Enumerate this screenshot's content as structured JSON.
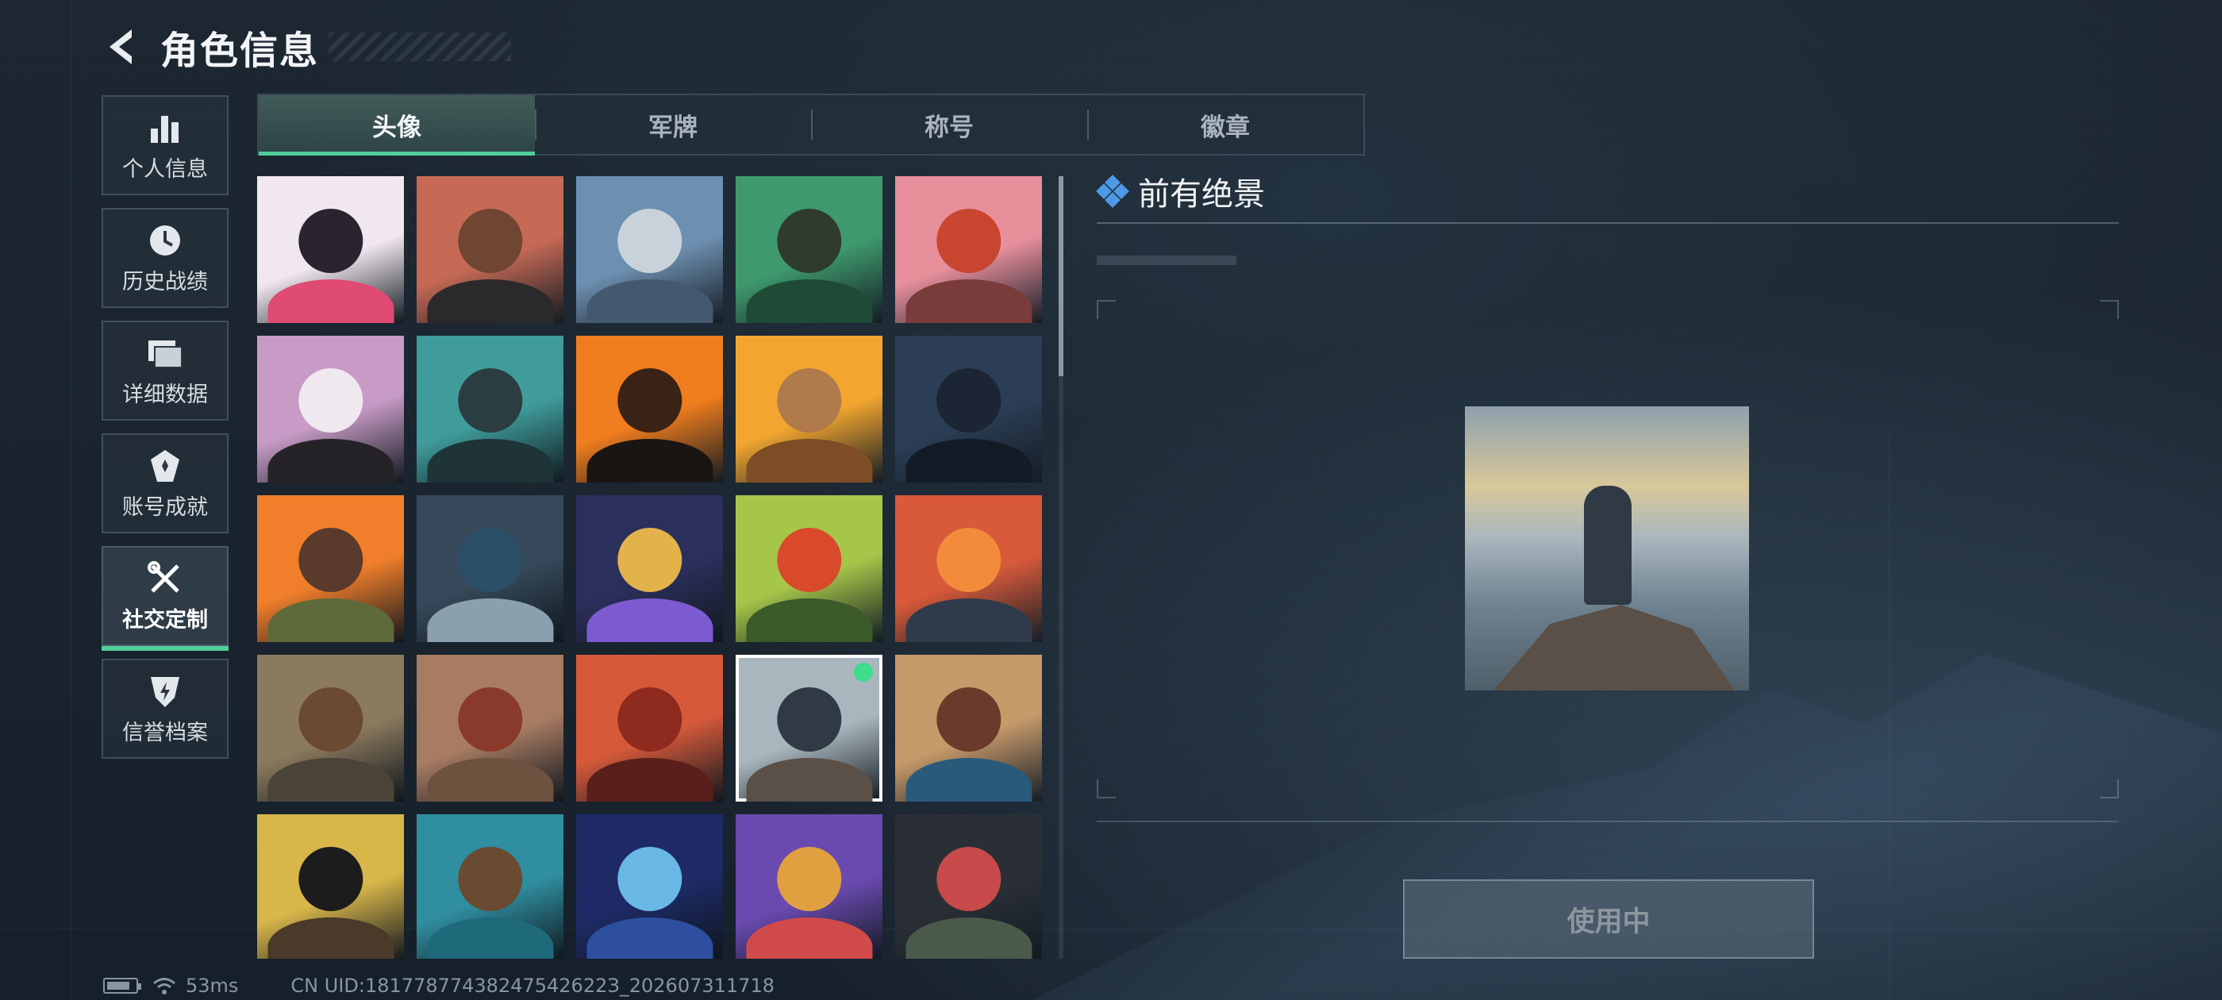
{
  "header": {
    "title": "角色信息"
  },
  "sidebar": {
    "items": [
      {
        "label": "个人信息",
        "icon": "bar-chart-icon",
        "active": false
      },
      {
        "label": "历史战绩",
        "icon": "clock-history-icon",
        "active": false
      },
      {
        "label": "详细数据",
        "icon": "folder-stack-icon",
        "active": false
      },
      {
        "label": "账号成就",
        "icon": "achievement-badge-icon",
        "active": false
      },
      {
        "label": "社交定制",
        "icon": "wrench-screwdriver-icon",
        "active": true
      },
      {
        "label": "信誉档案",
        "icon": "shield-bolt-icon",
        "active": false
      }
    ]
  },
  "tabs": [
    {
      "label": "头像",
      "active": true
    },
    {
      "label": "军牌",
      "active": false
    },
    {
      "label": "称号",
      "active": false
    },
    {
      "label": "徽章",
      "active": false
    }
  ],
  "avatars": [
    {
      "bg": "#f1e7ef",
      "head": "#2a2430",
      "body": "#e04b73"
    },
    {
      "bg": "#c76a55",
      "head": "#6e4632",
      "body": "#2b2a2a"
    },
    {
      "bg": "#6d8fb0",
      "head": "#c9d2da",
      "body": "#43596e"
    },
    {
      "bg": "#3e9a6d",
      "head": "#2f3b2f",
      "body": "#1f4a35"
    },
    {
      "bg": "#e88f9c",
      "head": "#c8462f",
      "body": "#7a3b3b"
    },
    {
      "bg": "#c79bc6",
      "head": "#f0e8ef",
      "body": "#252328"
    },
    {
      "bg": "#3f9c9a",
      "head": "#2b3d40",
      "body": "#1e3436"
    },
    {
      "bg": "#f07d1e",
      "head": "#3a2216",
      "body": "#1a1512"
    },
    {
      "bg": "#f2a62f",
      "head": "#b07a4a",
      "body": "#7e4d26"
    },
    {
      "bg": "#2c3e56",
      "head": "#1b2533",
      "body": "#131b26"
    },
    {
      "bg": "#f07e2a",
      "head": "#5a3a2a",
      "body": "#5e6a3a"
    },
    {
      "bg": "#36495a",
      "head": "#2a4f66",
      "body": "#8aa0ae"
    },
    {
      "bg": "#2b2f5c",
      "head": "#e3b24a",
      "body": "#7c5bd1"
    },
    {
      "bg": "#a6c64a",
      "head": "#d94a2a",
      "body": "#3b5a2a"
    },
    {
      "bg": "#d85a3a",
      "head": "#f28b3a",
      "body": "#2f3b4a"
    },
    {
      "bg": "#8c7a5e",
      "head": "#6a4a30",
      "body": "#4a4338"
    },
    {
      "bg": "#a87c62",
      "head": "#8a3a2a",
      "body": "#6e5240"
    },
    {
      "bg": "#d65a3a",
      "head": "#8e2a1e",
      "body": "#5a1f1a"
    },
    {
      "bg": "#a9b6bd",
      "head": "#2f3a44",
      "body": "#5a5047"
    },
    {
      "bg": "#c79a6a",
      "head": "#6a3a2a",
      "body": "#2a5a7a"
    },
    {
      "bg": "#d8b64a",
      "head": "#1c1c1c",
      "body": "#4a3a2a"
    },
    {
      "bg": "#2f8ea0",
      "head": "#6a4a30",
      "body": "#1f6a7a"
    },
    {
      "bg": "#1d2a66",
      "head": "#6ab8e6",
      "body": "#2e4fa0"
    },
    {
      "bg": "#6a4ab0",
      "head": "#e0a040",
      "body": "#d04a4a"
    },
    {
      "bg": "#2a2f36",
      "head": "#c84a4a",
      "body": "#4a5a4a"
    }
  ],
  "selected_avatar_index": 18,
  "detail": {
    "title": "前有绝景",
    "use_button_label": "使用中"
  },
  "status": {
    "ping": "53ms",
    "uid": "CN UID:18177877438247542622З_202607311718"
  },
  "colors": {
    "accent_green": "#4fcf9a",
    "in_use_dot": "#3fdc8c",
    "title_diamond": "#4d9be8"
  }
}
